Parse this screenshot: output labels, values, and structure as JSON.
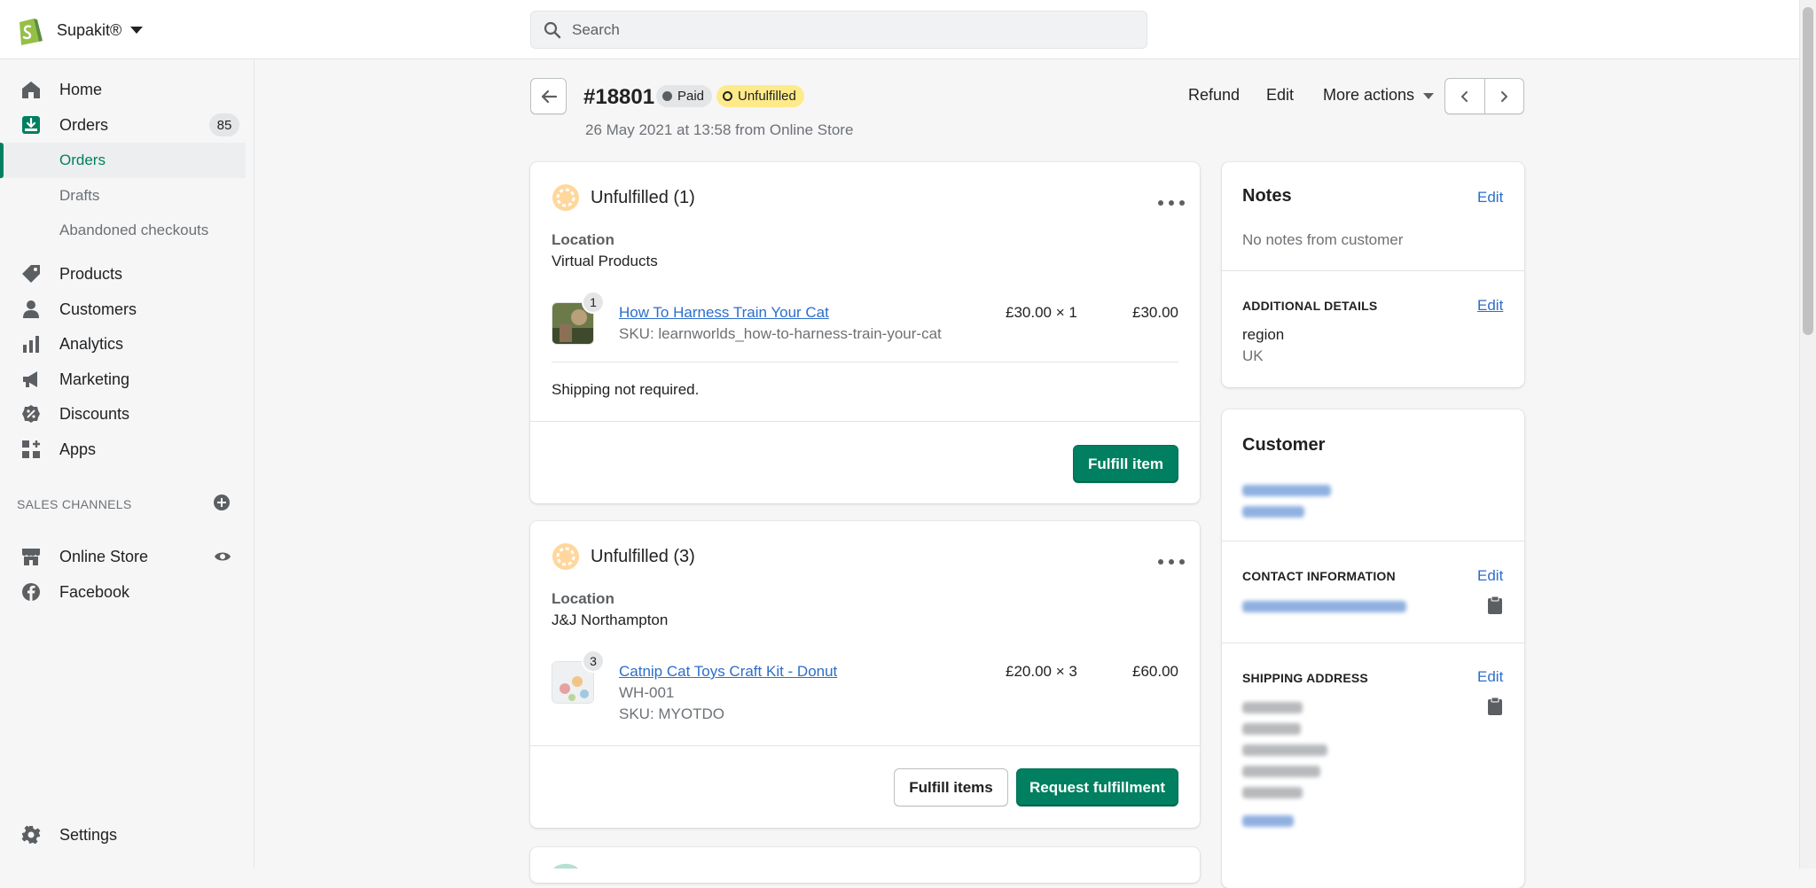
{
  "store": {
    "name": "Supakit®"
  },
  "search": {
    "placeholder": "Search"
  },
  "sidebar": {
    "items": [
      {
        "label": "Home",
        "icon": "home-icon"
      },
      {
        "label": "Orders",
        "icon": "orders-icon",
        "badge": "85"
      },
      {
        "label": "Products",
        "icon": "tag-icon"
      },
      {
        "label": "Customers",
        "icon": "person-icon"
      },
      {
        "label": "Analytics",
        "icon": "bar-chart-icon"
      },
      {
        "label": "Marketing",
        "icon": "megaphone-icon"
      },
      {
        "label": "Discounts",
        "icon": "discount-icon"
      },
      {
        "label": "Apps",
        "icon": "apps-icon"
      }
    ],
    "order_subitems": [
      "Orders",
      "Drafts",
      "Abandoned checkouts"
    ],
    "sales_channels_label": "SALES CHANNELS",
    "channels": [
      {
        "label": "Online Store",
        "icon": "store-icon"
      },
      {
        "label": "Facebook",
        "icon": "facebook-icon"
      }
    ],
    "settings_label": "Settings"
  },
  "order": {
    "number": "#18801",
    "payment_status": "Paid",
    "fulfillment_status": "Unfulfilled",
    "subtitle": "26 May 2021 at 13:58 from Online Store",
    "actions": {
      "refund": "Refund",
      "edit": "Edit",
      "more": "More actions"
    }
  },
  "fulfillment_cards": [
    {
      "title": "Unfulfilled (1)",
      "location_label": "Location",
      "location": "Virtual Products",
      "item": {
        "qty_badge": "1",
        "name": "How To Harness Train Your Cat",
        "meta": [
          "SKU: learnworlds_how-to-harness-train-your-cat"
        ],
        "price_qty": "£30.00 × 1",
        "total": "£30.00"
      },
      "note": "Shipping not required.",
      "buttons": [
        "Fulfill item"
      ]
    },
    {
      "title": "Unfulfilled (3)",
      "location_label": "Location",
      "location": "J&J Northampton",
      "item": {
        "qty_badge": "3",
        "name": "Catnip Cat Toys Craft Kit - Donut",
        "meta": [
          "WH-001",
          "SKU: MYOTDO"
        ],
        "price_qty": "£20.00 × 3",
        "total": "£60.00"
      },
      "buttons": [
        "Fulfill items",
        "Request fulfillment"
      ]
    }
  ],
  "notes": {
    "title": "Notes",
    "edit": "Edit",
    "empty": "No notes from customer"
  },
  "additional_details": {
    "title": "ADDITIONAL DETAILS",
    "edit": "Edit",
    "key": "region",
    "value": "UK"
  },
  "customer": {
    "title": "Customer",
    "contact_title": "CONTACT INFORMATION",
    "contact_edit": "Edit",
    "shipping_title": "SHIPPING ADDRESS",
    "shipping_edit": "Edit"
  },
  "colors": {
    "accent": "#008060",
    "link": "#2c6ecb",
    "unfulfilled_badge": "#ffea8a",
    "brand": "#95bf47"
  }
}
